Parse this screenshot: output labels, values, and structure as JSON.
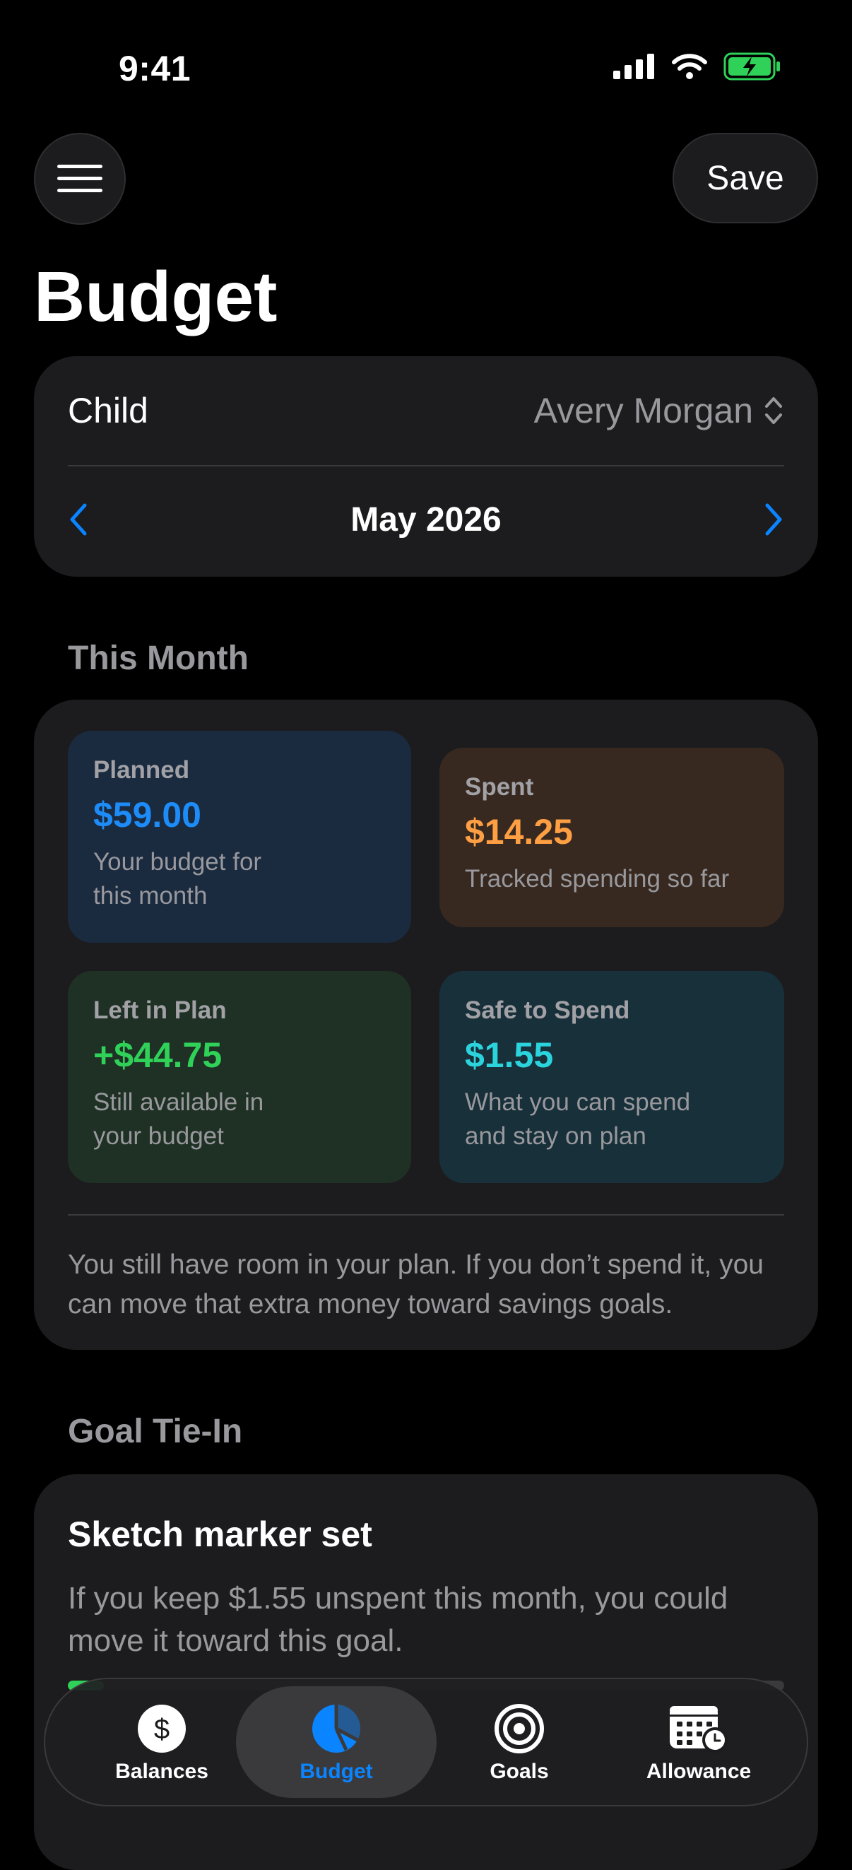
{
  "status_bar": {
    "time": "9:41"
  },
  "header": {
    "save_label": "Save",
    "title": "Budget"
  },
  "selector": {
    "child_label": "Child",
    "child_value": "Avery Morgan",
    "month": "May 2026"
  },
  "this_month": {
    "section_title": "This Month",
    "tiles": [
      {
        "label": "Planned",
        "value": "$59.00",
        "desc": "Your budget for this month"
      },
      {
        "label": "Spent",
        "value": "$14.25",
        "desc": "Tracked spending so far"
      },
      {
        "label": "Left in Plan",
        "value": "+$44.75",
        "desc": "Still available in your budget"
      },
      {
        "label": "Safe to Spend",
        "value": "$1.55",
        "desc": "What you can spend and stay on plan"
      }
    ],
    "note": "You still have room in your plan. If you don’t spend it, you can move that extra money toward savings goals."
  },
  "goal": {
    "section_title": "Goal Tie-In",
    "title": "Sketch marker set",
    "desc": "If you keep $1.55 unspent this month, you could move it toward this goal.",
    "progress_fraction": 0.05
  },
  "tabs": [
    {
      "label": "Balances",
      "icon": "dollar-circle-icon"
    },
    {
      "label": "Budget",
      "icon": "pie-chart-icon"
    },
    {
      "label": "Goals",
      "icon": "target-icon"
    },
    {
      "label": "Allowance",
      "icon": "calendar-clock-icon"
    }
  ],
  "colors": {
    "accent_blue": "#0a84ff",
    "planned": "#1d8cf8",
    "spent": "#ff9f43",
    "left": "#30d158",
    "safe": "#2bd4dd"
  }
}
